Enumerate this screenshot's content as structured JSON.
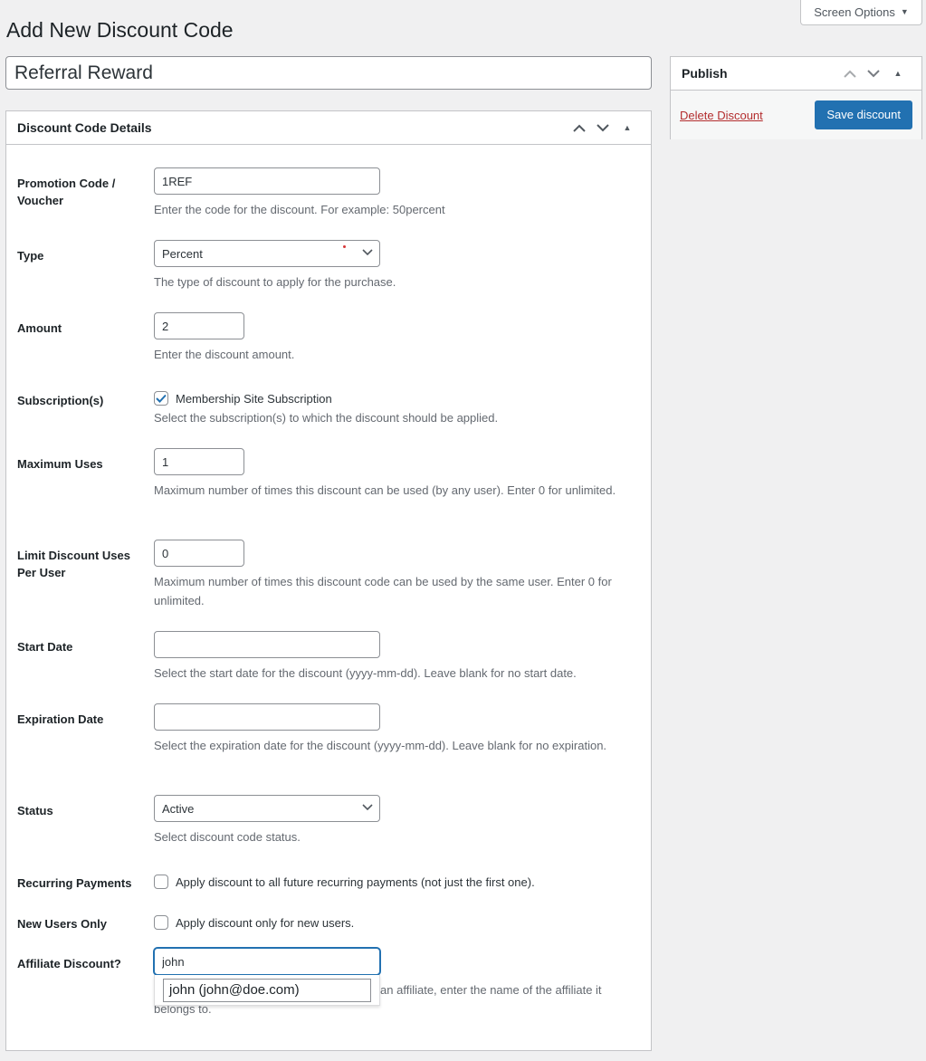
{
  "screen_options": {
    "label": "Screen Options",
    "icon": "triangle-down-icon"
  },
  "page": {
    "title": "Add New Discount Code"
  },
  "title_field": {
    "value": "Referral Reward"
  },
  "publish": {
    "title": "Publish",
    "delete_label": "Delete Discount",
    "save_label": "Save discount"
  },
  "details": {
    "title": "Discount Code Details",
    "fields": {
      "code": {
        "label": "Promotion Code / Voucher",
        "value": "1REF",
        "description": "Enter the code for the discount. For example: 50percent"
      },
      "type": {
        "label": "Type",
        "selected": "Percent",
        "description": "The type of discount to apply for the purchase."
      },
      "amount": {
        "label": "Amount",
        "value": "2",
        "description": "Enter the discount amount."
      },
      "subscriptions": {
        "label": "Subscription(s)",
        "option_label": "Membership Site Subscription",
        "checked": true,
        "description": "Select the subscription(s) to which the discount should be applied."
      },
      "max_uses": {
        "label": "Maximum Uses",
        "value": "1",
        "description": "Maximum number of times this discount can be used (by any user). Enter 0 for unlimited."
      },
      "limit_per_user": {
        "label": "Limit Discount Uses Per User",
        "value": "0",
        "description": "Maximum number of times this discount code can be used by the same user. Enter 0 for unlimited."
      },
      "start_date": {
        "label": "Start Date",
        "value": "",
        "description": "Select the start date for the discount (yyyy-mm-dd). Leave blank for no start date."
      },
      "expiration_date": {
        "label": "Expiration Date",
        "value": "",
        "description": "Select the expiration date for the discount (yyyy-mm-dd). Leave blank for no expiration."
      },
      "status": {
        "label": "Status",
        "selected": "Active",
        "description": "Select discount code status."
      },
      "recurring": {
        "label": "Recurring Payments",
        "option_label": "Apply discount to all future recurring payments (not just the first one).",
        "checked": false
      },
      "new_users": {
        "label": "New Users Only",
        "option_label": "Apply discount only for new users.",
        "checked": false
      },
      "affiliate": {
        "label": "Affiliate Discount?",
        "value": "john",
        "description": "If you would like to connect this discount to an affiliate, enter the name of the affiliate it belongs to.",
        "suggestions": [
          "john (john@doe.com)"
        ]
      }
    }
  },
  "colors": {
    "primary": "#2271b1",
    "delete": "#b32d2e",
    "background": "#f0f0f1"
  }
}
